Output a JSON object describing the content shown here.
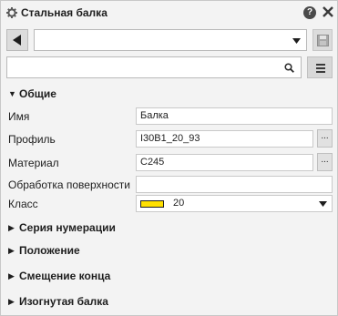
{
  "window": {
    "title": "Стальная балка",
    "help_label": "?"
  },
  "toolbar": {
    "preset_value": "",
    "search_placeholder": ""
  },
  "sections": {
    "general": {
      "label": "Общие",
      "expanded": true
    },
    "numbering": {
      "label": "Серия нумерации",
      "expanded": false
    },
    "position": {
      "label": "Положение",
      "expanded": false
    },
    "end_offset": {
      "label": "Смещение конца",
      "expanded": false
    },
    "curved_beam": {
      "label": "Изогнутая балка",
      "expanded": false
    }
  },
  "properties": {
    "name": {
      "label": "Имя",
      "value": "Балка"
    },
    "profile": {
      "label": "Профиль",
      "value": "I30B1_20_93",
      "browse": "..."
    },
    "material": {
      "label": "Материал",
      "value": "C245",
      "browse": "..."
    },
    "finish": {
      "label": "Обработка поверхности",
      "value": ""
    },
    "class": {
      "label": "Класс",
      "value": "20",
      "swatch_color": "#ffe000"
    }
  },
  "colors": {
    "panel_bg": "#f3f3f3",
    "field_bg": "#ffffff",
    "border": "#c9c9c9",
    "button_bg": "#dcdcdc"
  }
}
